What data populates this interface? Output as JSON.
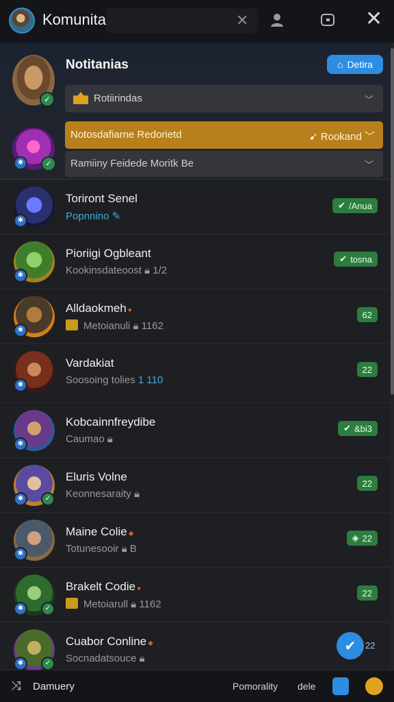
{
  "header": {
    "title": "Komunitas",
    "search_placeholder": ""
  },
  "hero": {
    "title": "Notitanias",
    "button_label": "Detira",
    "select_label": "Rotiirindas"
  },
  "featured": {
    "gold_label": "Notosdafiarne Redorietd",
    "gold_right": "Rookand",
    "dark_select_label": "Ramiiny Feidede Moritk Be"
  },
  "rows": [
    {
      "name": "Toriront Senel",
      "sub": "Popnnino",
      "pill": "/Anua"
    },
    {
      "name": "Pioriigi Ogbleant",
      "sub": "Kookinsdateoost",
      "sub_extra": "1/2",
      "pill": "tosna"
    },
    {
      "name": "Alldaokmeh",
      "sub": "Metoianuli",
      "sub_extra": "1162",
      "pill": "62"
    },
    {
      "name": "Vardakiat",
      "sub": "Soosoing tolies",
      "sub_extra": "1 110",
      "pill": "22"
    },
    {
      "name": "Kobcainnfreydibe",
      "sub": "Caumao",
      "pill": "&bi3"
    },
    {
      "name": "Eluris Volne",
      "sub": "Keonnesaraity",
      "pill": "22"
    },
    {
      "name": "Maine Colie",
      "sub": "Totunesooir",
      "sub_extra": "B",
      "pill": "22"
    },
    {
      "name": "Brakelt Codie",
      "sub": "Metoiarull",
      "sub_extra": "1162",
      "pill": "22"
    },
    {
      "name": "Cuabor Conline",
      "sub": "Socnadatsouce",
      "pill": "22"
    }
  ],
  "bottom": {
    "left_label": "Damuery",
    "text1": "Pomorality",
    "text2": "dele"
  },
  "colors": {
    "accent_blue": "#2d8de0",
    "accent_gold": "#b7801c",
    "pill_green": "#2c7d3f"
  }
}
